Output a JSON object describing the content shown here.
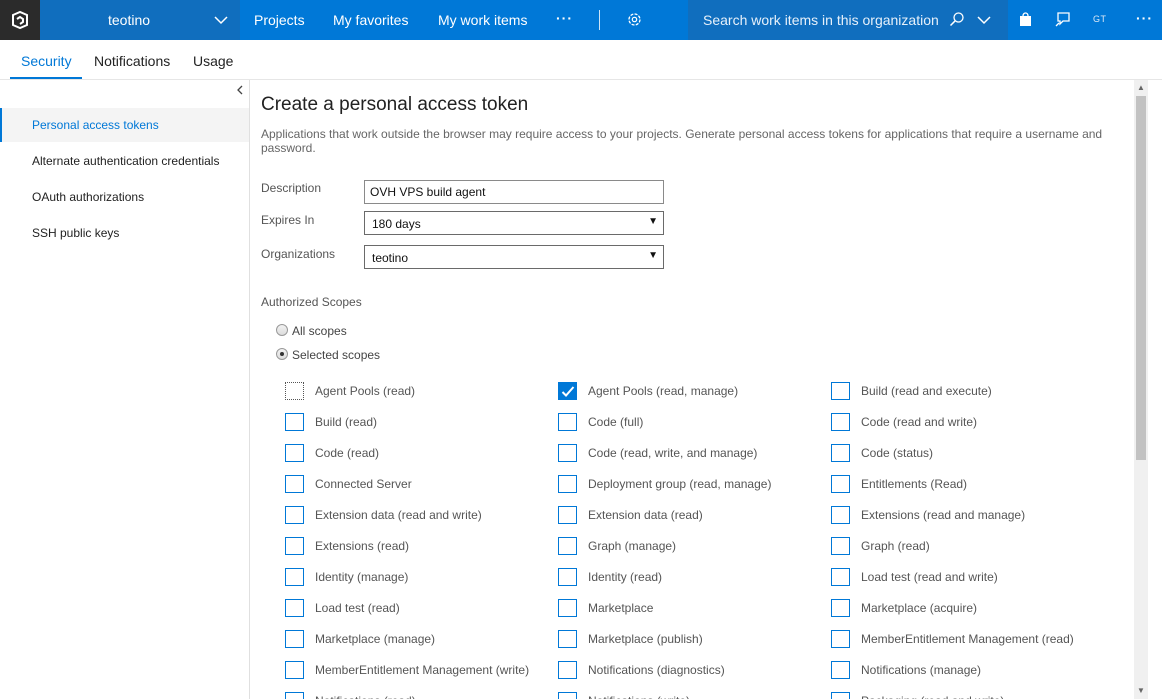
{
  "topbar": {
    "org_name": "teotino",
    "nav": [
      "Projects",
      "My favorites",
      "My work items"
    ],
    "more": "···",
    "search_placeholder": "Search work items in this organization",
    "avatar_initials": "GT",
    "overflow": "···",
    "accent": "#0078d7"
  },
  "tabs": [
    "Security",
    "Notifications",
    "Usage"
  ],
  "leftnav": {
    "items": [
      "Personal access tokens",
      "Alternate authentication credentials",
      "OAuth authorizations",
      "SSH public keys"
    ],
    "selected": "Personal access tokens"
  },
  "form": {
    "title": "Create a personal access token",
    "intro": "Applications that work outside the browser may require access to your projects. Generate personal access tokens for applications that require a username and password.",
    "description_label": "Description",
    "description_value": "OVH VPS build agent",
    "expires_label": "Expires In",
    "expires_value": "180 days",
    "orgs_label": "Organizations",
    "orgs_value": "teotino",
    "scopes_heading": "Authorized Scopes",
    "radio_all": "All scopes",
    "radio_selected": "Selected scopes",
    "radio_selected_value": "Selected scopes"
  },
  "scopes": [
    {
      "label": "Agent Pools (read)",
      "checked": false,
      "focus": true
    },
    {
      "label": "Agent Pools (read, manage)",
      "checked": true
    },
    {
      "label": "Build (read and execute)",
      "checked": false
    },
    {
      "label": "Build (read)",
      "checked": false
    },
    {
      "label": "Code (full)",
      "checked": false
    },
    {
      "label": "Code (read and write)",
      "checked": false
    },
    {
      "label": "Code (read)",
      "checked": false
    },
    {
      "label": "Code (read, write, and manage)",
      "checked": false
    },
    {
      "label": "Code (status)",
      "checked": false
    },
    {
      "label": "Connected Server",
      "checked": false
    },
    {
      "label": "Deployment group (read, manage)",
      "checked": false
    },
    {
      "label": "Entitlements (Read)",
      "checked": false
    },
    {
      "label": "Extension data (read and write)",
      "checked": false
    },
    {
      "label": "Extension data (read)",
      "checked": false
    },
    {
      "label": "Extensions (read and manage)",
      "checked": false
    },
    {
      "label": "Extensions (read)",
      "checked": false
    },
    {
      "label": "Graph (manage)",
      "checked": false
    },
    {
      "label": "Graph (read)",
      "checked": false
    },
    {
      "label": "Identity (manage)",
      "checked": false
    },
    {
      "label": "Identity (read)",
      "checked": false
    },
    {
      "label": "Load test (read and write)",
      "checked": false
    },
    {
      "label": "Load test (read)",
      "checked": false
    },
    {
      "label": "Marketplace",
      "checked": false
    },
    {
      "label": "Marketplace (acquire)",
      "checked": false
    },
    {
      "label": "Marketplace (manage)",
      "checked": false
    },
    {
      "label": "Marketplace (publish)",
      "checked": false
    },
    {
      "label": "MemberEntitlement Management (read)",
      "checked": false
    },
    {
      "label": "MemberEntitlement Management (write)",
      "checked": false
    },
    {
      "label": "Notifications (diagnostics)",
      "checked": false
    },
    {
      "label": "Notifications (manage)",
      "checked": false
    },
    {
      "label": "Notifications (read)",
      "checked": false
    },
    {
      "label": "Notifications (write)",
      "checked": false
    },
    {
      "label": "Packaging (read and write)",
      "checked": false
    }
  ]
}
